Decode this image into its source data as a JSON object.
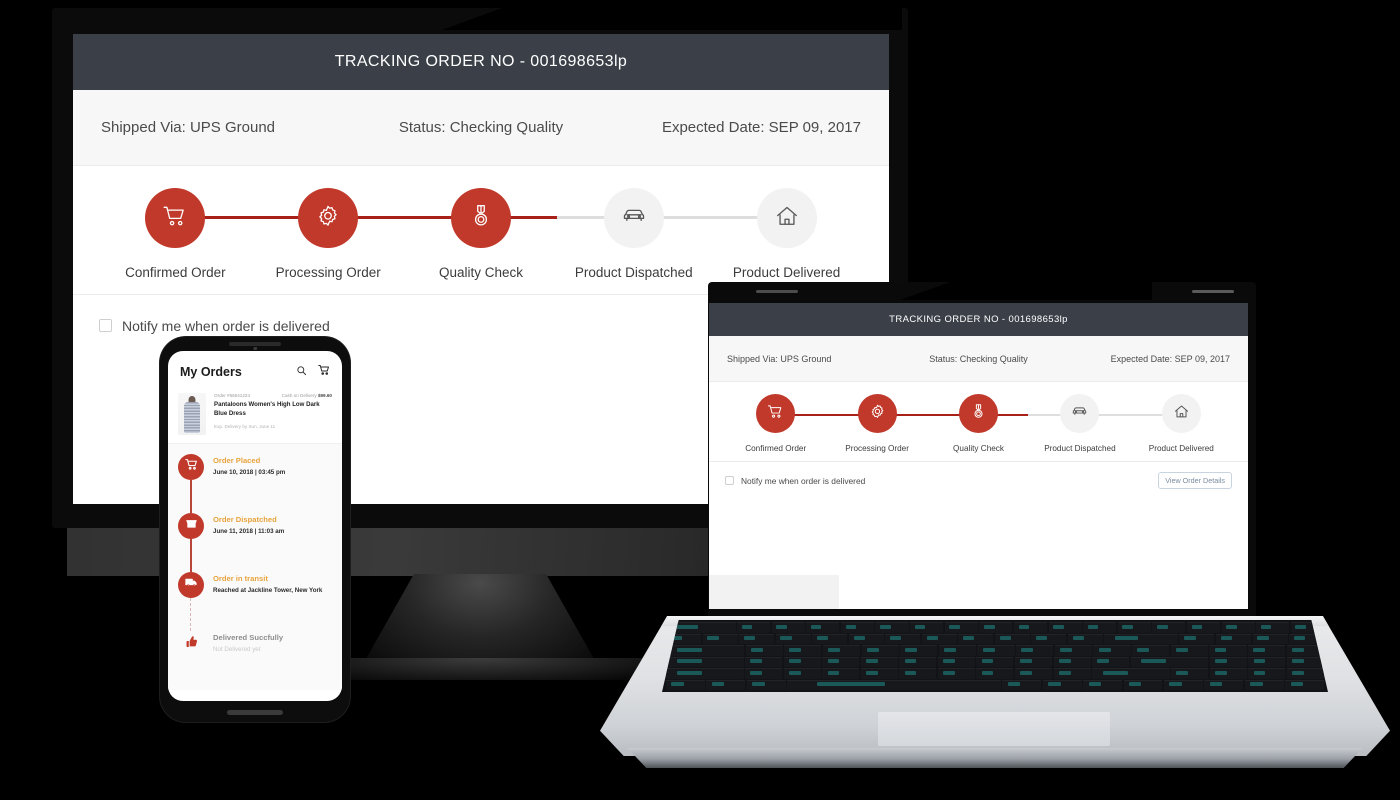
{
  "tracking": {
    "title": "TRACKING ORDER NO - 001698653lp",
    "meta": {
      "shipped_via": "Shipped Via: UPS Ground",
      "status": "Status: Checking Quality",
      "expected_date": "Expected Date: SEP 09, 2017"
    },
    "steps": [
      {
        "label": "Confirmed Order",
        "icon": "shopping-cart-icon",
        "done": true
      },
      {
        "label": "Processing Order",
        "icon": "gear-icon",
        "done": true
      },
      {
        "label": "Quality Check",
        "icon": "medal-icon",
        "done": true
      },
      {
        "label": "Product Dispatched",
        "icon": "car-icon",
        "done": false
      },
      {
        "label": "Product Delivered",
        "icon": "home-icon",
        "done": false
      }
    ],
    "footer": {
      "notify_label": "Notify me when order is delivered",
      "notify_checked": false,
      "view_details_label": "View Order Details"
    },
    "colors": {
      "titlebar_bg": "#3b4048",
      "active_red": "#c0392b",
      "track_fill": "#a82018",
      "inactive_gray": "#f2f2f2",
      "meta_bg": "#f7f7f7",
      "button_border": "#c8d4e0",
      "button_text": "#7b8c9e"
    }
  },
  "phone": {
    "header": {
      "title": "My Orders",
      "search_icon": "search-icon",
      "cart_icon": "shopping-cart-icon"
    },
    "order": {
      "order_no": "Order #66541224",
      "payment": "Cash on Delivery",
      "amount": "$99.60",
      "product_name": "Pantaloons Women's High Low Dark Blue Dress",
      "delivery_note": "Exp. Delivery by Sun, June 11"
    },
    "timeline": [
      {
        "title": "Order Placed",
        "sub": "June 10, 2018  |  03:45 pm",
        "icon": "shopping-cart-icon",
        "state": "done"
      },
      {
        "title": "Order Dispatched",
        "sub": "June 11, 2018  |  11:03 am",
        "icon": "store-icon",
        "state": "done"
      },
      {
        "title": "Order in transit",
        "sub": "Reached at Jackline Tower, New York",
        "icon": "truck-icon",
        "state": "done"
      },
      {
        "title": "Delivered Succfully",
        "sub": "Not Delivered yet",
        "icon": "thumbs-up-icon",
        "state": "pending"
      }
    ],
    "colors": {
      "accent_orange": "#e8a33d",
      "dot_red": "#c0392b",
      "pending_gray": "#8e8e8e"
    }
  }
}
